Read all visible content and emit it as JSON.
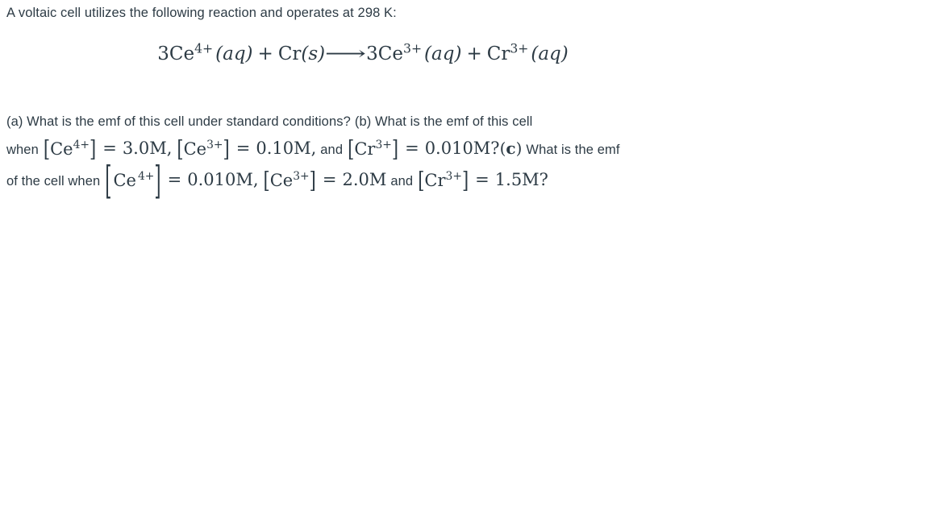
{
  "document": {
    "background_color": "#ffffff",
    "text_color": "#2d3b45",
    "intro": "A voltaic cell utilizes the following reaction and operates at 298 K:",
    "equation": {
      "label": "balanced-redox-equation",
      "reactant_1_coefficient": "3",
      "reactant_1_species": "Ce",
      "reactant_1_charge": "4+",
      "reactant_1_state": "(aq)",
      "plus_1": "+",
      "reactant_2_species": "Cr",
      "reactant_2_state": "(s)",
      "arrow": "⟶",
      "product_1_coefficient": "3",
      "product_1_species": "Ce",
      "product_1_charge": "3+",
      "product_1_state": "(aq)",
      "plus_2": "+",
      "product_2_species": "Cr",
      "product_2_charge": "3+",
      "product_2_state": "(aq)"
    },
    "question": {
      "part_a": "(a) What is the emf of this cell under standard conditions?",
      "part_b_lead": "(b) What is the emf of this cell",
      "part_b_when": "when",
      "part_b_conc_1_open": "[",
      "part_b_conc_1_species": "Ce",
      "part_b_conc_1_charge": "4+",
      "part_b_conc_1_close": "]",
      "part_b_eq_1": "=",
      "part_b_val_1": "3.0M,",
      "part_b_conc_2_open": "[",
      "part_b_conc_2_species": "Ce",
      "part_b_conc_2_charge": "3+",
      "part_b_conc_2_close": "]",
      "part_b_eq_2": "=",
      "part_b_val_2": "0.10M,",
      "part_b_and": "and",
      "part_b_conc_3_open": "[",
      "part_b_conc_3_species": "Cr",
      "part_b_conc_3_charge": "3+",
      "part_b_conc_3_close": "]",
      "part_b_eq_3": "=",
      "part_b_val_3": "0.010M?",
      "part_c_open": "(",
      "part_c_letter": "c",
      "part_c_close": ")",
      "part_c_lead": "What is the emf",
      "part_c_of_the_cell_when": "of the cell when",
      "part_c_conc_1_open": "[",
      "part_c_conc_1_species": "Ce",
      "part_c_conc_1_charge": "4+",
      "part_c_conc_1_close": "]",
      "part_c_eq_1": "=",
      "part_c_val_1": "0.010M,",
      "part_c_conc_2_open": "[",
      "part_c_conc_2_species": "Ce",
      "part_c_conc_2_charge": "3+",
      "part_c_conc_2_close": "]",
      "part_c_eq_2": "=",
      "part_c_val_2": "2.0M",
      "part_c_and": "and",
      "part_c_conc_3_open": "[",
      "part_c_conc_3_species": "Cr",
      "part_c_conc_3_charge": "3+",
      "part_c_conc_3_close": "]",
      "part_c_eq_3": "=",
      "part_c_val_3": "1.5M?"
    }
  }
}
